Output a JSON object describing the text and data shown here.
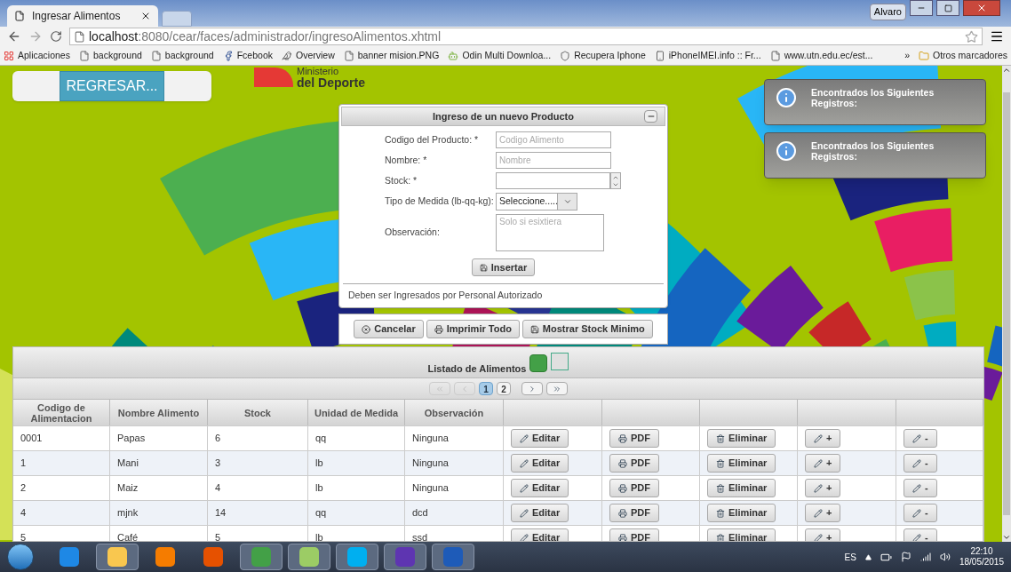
{
  "browser": {
    "tabs": [
      {
        "title": "Ingresar Alimentos",
        "selected": true
      }
    ],
    "user": "Alvaro",
    "url_host": "localhost",
    "url_rest": ":8080/cear/faces/administrador/ingresoAlimentos.xhtml",
    "bookmarks": [
      {
        "kind": "apps",
        "label": "Aplicaciones"
      },
      {
        "kind": "page",
        "label": "background"
      },
      {
        "kind": "page",
        "label": "background"
      },
      {
        "kind": "facebook",
        "label": "Fcebook"
      },
      {
        "kind": "bird",
        "label": "Overview"
      },
      {
        "kind": "page",
        "label": "banner mision.PNG"
      },
      {
        "kind": "android",
        "label": "Odin Multi Downloa..."
      },
      {
        "kind": "shield",
        "label": "Recupera Iphone"
      },
      {
        "kind": "phone",
        "label": "iPhoneIMEI.info :: Fr..."
      },
      {
        "kind": "page",
        "label": "www.utn.edu.ec/est..."
      }
    ],
    "more": "»",
    "other_bookmarks": "Otros marcadores"
  },
  "page": {
    "back_button": "REGRESAR...",
    "logo": [
      "Ministerio",
      "del Deporte"
    ],
    "dialog": {
      "title": "Ingreso de un nuevo Producto",
      "fields": [
        {
          "kind": "text",
          "label": "Codigo del Producto: *",
          "placeholder": "Codigo Alimento"
        },
        {
          "kind": "text",
          "label": "Nombre: *",
          "placeholder": "Nombre"
        },
        {
          "kind": "spinner",
          "label": "Stock: *"
        },
        {
          "kind": "select",
          "label": "Tipo de Medida (lb-qq-kg):",
          "value": "Seleccione....."
        },
        {
          "kind": "textarea",
          "label": "Observación:",
          "placeholder": "Solo si esixtiera"
        }
      ],
      "submit": "Insertar",
      "note": "Deben ser Ingresados por Personal Autorizado",
      "buttons": [
        {
          "kind": "cancel",
          "label": "Cancelar"
        },
        {
          "kind": "print",
          "label": "Imprimir Todo"
        },
        {
          "kind": "save",
          "label": "Mostrar Stock Minimo"
        }
      ]
    },
    "notifications": [
      {
        "text": "Encontrados los Siguientes Registros:"
      },
      {
        "text": "Encontrados los Siguientes Registros:"
      }
    ],
    "table": {
      "title": "Listado de Alimentos",
      "pages": [
        {
          "label": "1",
          "selected": true
        },
        {
          "label": "2",
          "selected": false
        }
      ],
      "columns": [
        "Codigo de Alimentacion",
        "Nombre Alimento",
        "Stock",
        "Unidad de Medida",
        "Observación"
      ],
      "rows": [
        {
          "cells": [
            "0001",
            "Papas",
            "6",
            "qq",
            "Ninguna"
          ],
          "actions": [
            {
              "kind": "edit",
              "label": "Editar"
            },
            {
              "kind": "pdf",
              "label": "PDF"
            },
            {
              "kind": "delete",
              "label": "Eliminar"
            },
            {
              "kind": "edit",
              "label": "+"
            },
            {
              "kind": "edit",
              "label": "-"
            }
          ]
        },
        {
          "cells": [
            "1",
            "Mani",
            "3",
            "lb",
            "Ninguna"
          ],
          "actions": [
            {
              "kind": "edit",
              "label": "Editar"
            },
            {
              "kind": "pdf",
              "label": "PDF"
            },
            {
              "kind": "delete",
              "label": "Eliminar"
            },
            {
              "kind": "edit",
              "label": "+"
            },
            {
              "kind": "edit",
              "label": "-"
            }
          ]
        },
        {
          "cells": [
            "2",
            "Maiz",
            "4",
            "lb",
            "Ninguna"
          ],
          "actions": [
            {
              "kind": "edit",
              "label": "Editar"
            },
            {
              "kind": "pdf",
              "label": "PDF"
            },
            {
              "kind": "delete",
              "label": "Eliminar"
            },
            {
              "kind": "edit",
              "label": "+"
            },
            {
              "kind": "edit",
              "label": "-"
            }
          ]
        },
        {
          "cells": [
            "4",
            "mjnk",
            "14",
            "qq",
            "dcd"
          ],
          "actions": [
            {
              "kind": "edit",
              "label": "Editar"
            },
            {
              "kind": "pdf",
              "label": "PDF"
            },
            {
              "kind": "delete",
              "label": "Eliminar"
            },
            {
              "kind": "edit",
              "label": "+"
            },
            {
              "kind": "edit",
              "label": "-"
            }
          ]
        },
        {
          "cells": [
            "5",
            "Café",
            "5",
            "lb",
            "ssd"
          ],
          "actions": [
            {
              "kind": "edit",
              "label": "Editar"
            },
            {
              "kind": "pdf",
              "label": "PDF"
            },
            {
              "kind": "delete",
              "label": "Eliminar"
            },
            {
              "kind": "edit",
              "label": "+"
            },
            {
              "kind": "edit",
              "label": "-"
            }
          ]
        }
      ]
    }
  },
  "taskbar": {
    "apps": [
      {
        "kind": "ie",
        "selected": false
      },
      {
        "kind": "explorer",
        "selected": true
      },
      {
        "kind": "media",
        "selected": false
      },
      {
        "kind": "firefox",
        "selected": false
      },
      {
        "kind": "chrome",
        "selected": true
      },
      {
        "kind": "notes",
        "selected": true
      },
      {
        "kind": "skype",
        "selected": true
      },
      {
        "kind": "ide",
        "selected": true
      },
      {
        "kind": "word",
        "selected": true
      }
    ],
    "language": "ES",
    "time": "22:10",
    "date": "18/05/2015"
  }
}
